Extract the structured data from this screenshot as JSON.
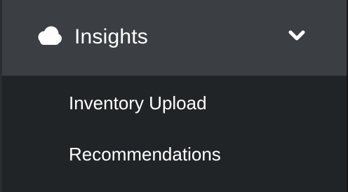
{
  "nav_group": {
    "icon": "cloud-icon",
    "title": "Insights",
    "expand_icon": "chevron-down-icon",
    "expanded": true,
    "items": [
      {
        "label": "Inventory Upload"
      },
      {
        "label": "Recommendations"
      }
    ]
  },
  "colors": {
    "header_background": "#3b3f43",
    "menu_background": "#212427",
    "text": "#ffffff"
  }
}
